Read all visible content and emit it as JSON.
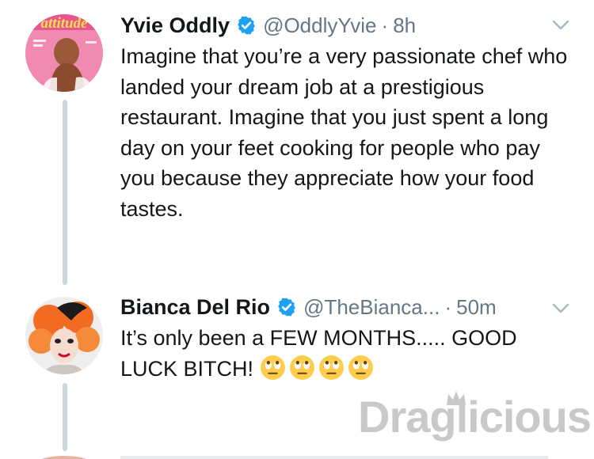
{
  "tweets": [
    {
      "name": "Yvie Oddly",
      "handle": "@OddlyYvie",
      "separator": "·",
      "time": "8h",
      "text": "Imagine that you’re a very passionate chef who landed your dream job at a prestigious restaurant. Imagine that you just spent a long day on your feet cooking for people who pay you because they appreciate how your food tastes.",
      "verified": true,
      "avatar_magazine_title": "attitude"
    },
    {
      "name": "Bianca Del Rio",
      "handle": "@TheBianca...",
      "separator": "·",
      "time": "50m",
      "text": "It’s only been a FEW MONTHS..... GOOD LUCK BITCH!",
      "verified": true,
      "emoji_count": 4
    }
  ],
  "watermark": {
    "text": "Draglicious"
  },
  "colors": {
    "verified_blue": "#1da1f2",
    "secondary_text": "#657786",
    "thread_line": "#ccd6dd"
  }
}
